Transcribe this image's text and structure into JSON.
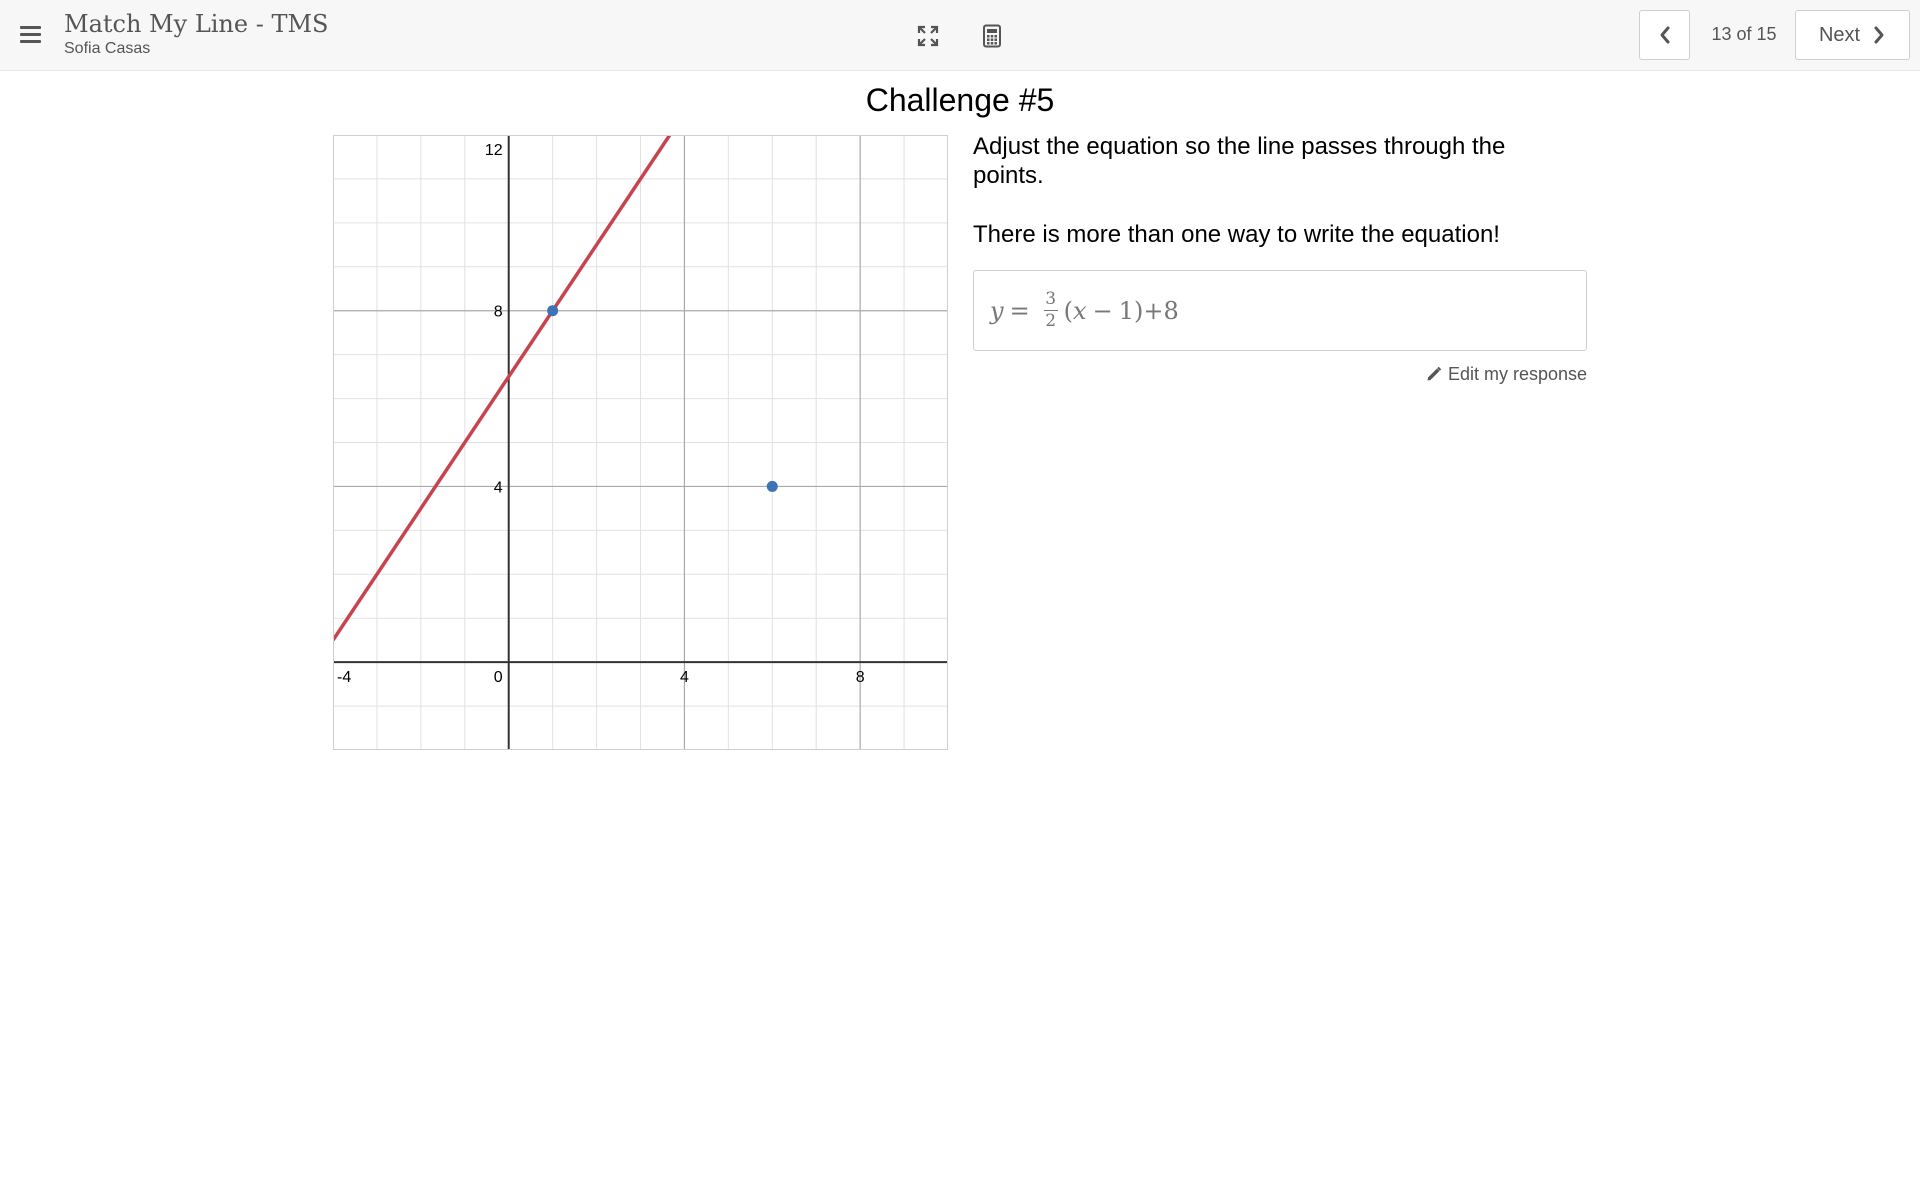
{
  "header": {
    "app_title": "Match My Line - TMS",
    "user_name": "Sofia Casas",
    "page_indicator": "13 of 15",
    "next_label": "Next",
    "icons": [
      "menu-icon",
      "fullscreen-icon",
      "calculator-icon",
      "chevron-left-icon",
      "chevron-right-icon"
    ]
  },
  "main": {
    "title": "Challenge #5",
    "prompt": "Adjust the equation so the line passes through the points.",
    "prompt_2": "There is more than one way to write the equation!",
    "equation": {
      "lhs": "y",
      "equals": "=",
      "numerator": "3",
      "denominator": "2",
      "paren_open": "(",
      "variable": "x",
      "minus": "−",
      "constant": "1",
      "paren_close": ")",
      "plus": "+",
      "offset": "8"
    },
    "edit_label": "Edit my response"
  },
  "chart_data": {
    "type": "scatter",
    "x_ticks": [
      "-4",
      "0",
      "4",
      "8"
    ],
    "y_ticks": [
      "4",
      "8",
      "12"
    ],
    "xlim": [
      -4,
      10
    ],
    "ylim": [
      -2,
      12
    ],
    "grid": true,
    "points": [
      {
        "x": 1,
        "y": 8
      },
      {
        "x": 6,
        "y": 4
      }
    ],
    "line": {
      "slope": 1.5,
      "through": {
        "x": 1,
        "y": 8
      }
    },
    "colors": {
      "line": "#c74350",
      "point": "#3b73b6",
      "axis": "#333333",
      "major_grid": "#a9a9a9",
      "minor_grid": "#e2e2e2"
    }
  }
}
